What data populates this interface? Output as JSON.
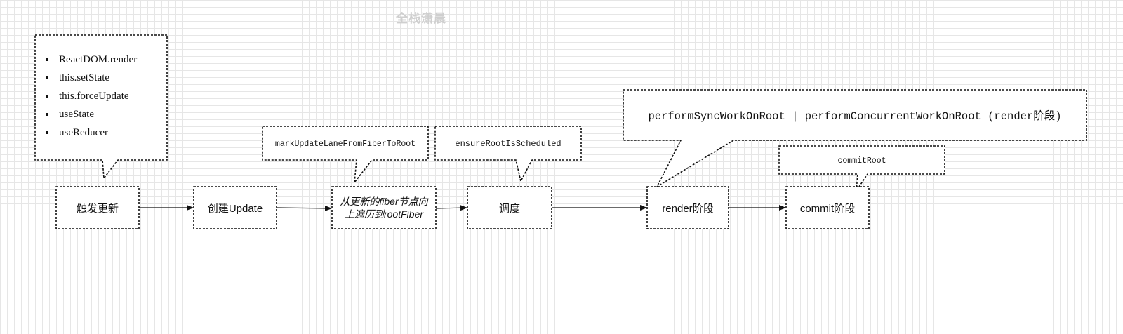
{
  "watermark": "全栈潇晨",
  "triggers": [
    "ReactDOM.render",
    "this.setState",
    "this.forceUpdate",
    "useState",
    "useReducer"
  ],
  "nodes": {
    "trigger_update": "触发更新",
    "create_update": "创建Update",
    "bubble_line1": "从更新的fiber节点向",
    "bubble_line2": "上遍历到rootFiber",
    "schedule": "调度",
    "render_phase": "render阶段",
    "commit_phase": "commit阶段"
  },
  "callouts": {
    "mark_update": "markUpdateLaneFromFiberToRoot",
    "ensure_root": "ensureRootIsScheduled",
    "perform_work": "performSyncWorkOnRoot | performConcurrentWorkOnRoot (render阶段)",
    "commit_root": "commitRoot"
  },
  "colors": {
    "stroke": "#111111",
    "grid": "#e6e6e6",
    "watermark": "#cfcfcf"
  }
}
